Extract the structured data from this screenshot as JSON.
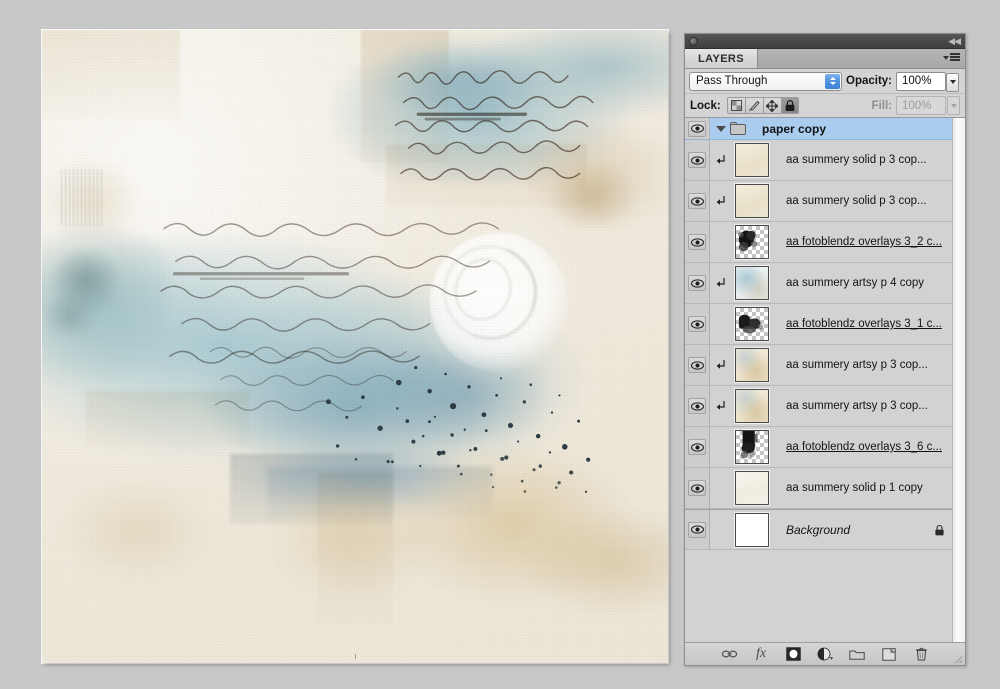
{
  "window": {
    "panel_tab": "LAYERS",
    "titlebar_collapse": "collapse-to-icons"
  },
  "controls": {
    "blend_mode": "Pass Through",
    "opacity_label": "Opacity:",
    "opacity_value": "100%",
    "lock_label": "Lock:",
    "fill_label": "Fill:",
    "fill_value": "100%",
    "lock_buttons": [
      {
        "name": "lock-transparent-pixels",
        "active": false
      },
      {
        "name": "lock-image-pixels",
        "active": false
      },
      {
        "name": "lock-position",
        "active": false
      },
      {
        "name": "lock-all",
        "active": true
      }
    ]
  },
  "layers": [
    {
      "name": "paper copy",
      "type": "group",
      "expanded": true,
      "selected": true,
      "visible": true,
      "clipped": false,
      "underlined": false,
      "thumb": "none"
    },
    {
      "name": "aa summery solid p 3 cop...",
      "type": "layer",
      "expanded": false,
      "selected": false,
      "visible": true,
      "clipped": true,
      "underlined": false,
      "thumb": "paper-a"
    },
    {
      "name": "aa summery solid p 3 cop...",
      "type": "layer",
      "expanded": false,
      "selected": false,
      "visible": true,
      "clipped": true,
      "underlined": false,
      "thumb": "paper-a"
    },
    {
      "name": "aa fotoblendz overlays 3_2 c...",
      "type": "layer",
      "expanded": false,
      "selected": false,
      "visible": true,
      "clipped": false,
      "underlined": true,
      "thumb": "blendz-2"
    },
    {
      "name": "aa summery artsy p 4 copy",
      "type": "layer",
      "expanded": false,
      "selected": false,
      "visible": true,
      "clipped": true,
      "underlined": false,
      "thumb": "artsy-blue"
    },
    {
      "name": "aa fotoblendz overlays 3_1 c...",
      "type": "layer",
      "expanded": false,
      "selected": false,
      "visible": true,
      "clipped": false,
      "underlined": true,
      "thumb": "blendz-1"
    },
    {
      "name": "aa summery artsy p 3 cop...",
      "type": "layer",
      "expanded": false,
      "selected": false,
      "visible": true,
      "clipped": true,
      "underlined": false,
      "thumb": "artsy-tan"
    },
    {
      "name": "aa summery artsy p 3 cop...",
      "type": "layer",
      "expanded": false,
      "selected": false,
      "visible": true,
      "clipped": true,
      "underlined": false,
      "thumb": "artsy-tan"
    },
    {
      "name": "aa fotoblendz overlays 3_6 c...",
      "type": "layer",
      "expanded": false,
      "selected": false,
      "visible": true,
      "clipped": false,
      "underlined": true,
      "thumb": "blendz-6"
    },
    {
      "name": "aa summery solid p 1 copy",
      "type": "layer",
      "expanded": false,
      "selected": false,
      "visible": true,
      "clipped": false,
      "underlined": false,
      "thumb": "paper-b"
    },
    {
      "name": "Background",
      "type": "background",
      "expanded": false,
      "selected": false,
      "visible": true,
      "clipped": false,
      "underlined": false,
      "thumb": "white",
      "locked": true
    }
  ],
  "footer_buttons": [
    {
      "label": "link-layers",
      "icon": "link-icon"
    },
    {
      "label": "layer-style",
      "icon": "fx-icon"
    },
    {
      "label": "add-layer-mask",
      "icon": "mask-icon"
    },
    {
      "label": "new-adjustment-layer",
      "icon": "adjustment-icon"
    },
    {
      "label": "new-group",
      "icon": "folder-icon"
    },
    {
      "label": "new-layer",
      "icon": "new-layer-icon"
    },
    {
      "label": "delete-layer",
      "icon": "trash-icon"
    }
  ],
  "colors": {
    "selection_blue": "#a9ccef",
    "panel_bg": "#d4d4d4",
    "list_bg": "#d2d2d2",
    "app_bg": "#c8c8c8",
    "titlebar": "#4a4a4a"
  },
  "canvas": {
    "description": "mixed-media watercolor collage artwork"
  }
}
